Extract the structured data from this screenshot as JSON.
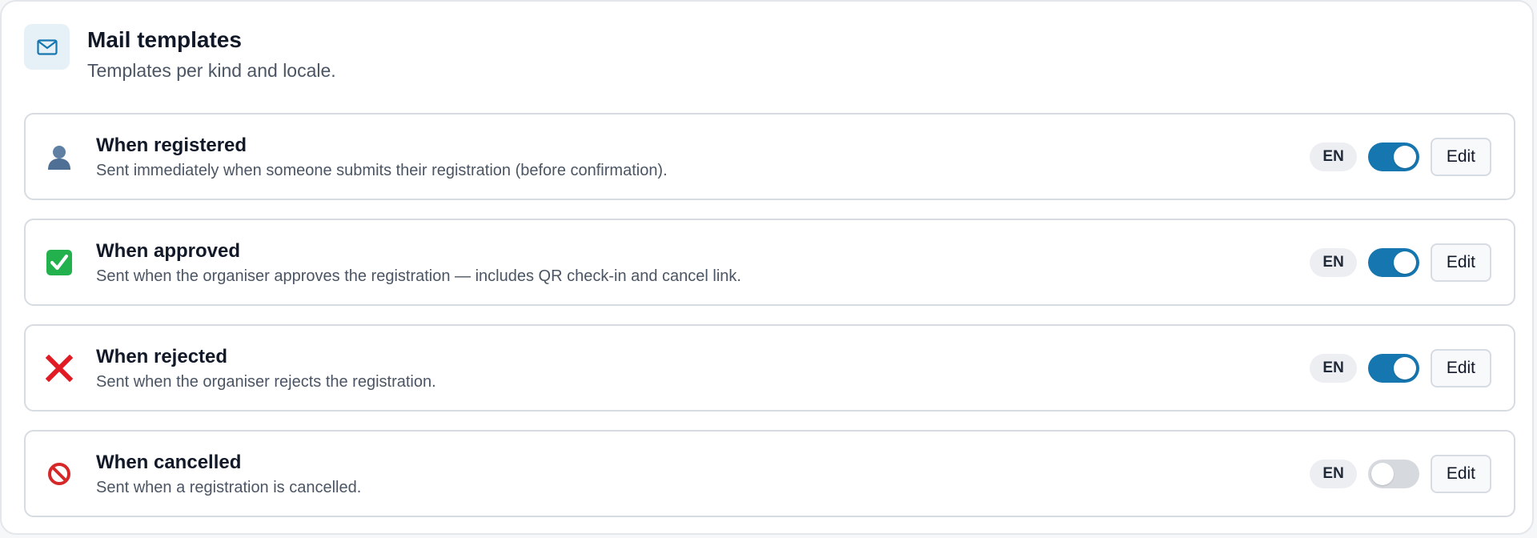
{
  "header": {
    "title": "Mail templates",
    "subtitle": "Templates per kind and locale.",
    "icon": "mail-icon",
    "accent": "#1677b0"
  },
  "templates": [
    {
      "title": "When registered",
      "description": "Sent immediately when someone submits their registration (before confirmation).",
      "icon": "person-icon",
      "locale": "EN",
      "enabled": true,
      "edit_label": "Edit"
    },
    {
      "title": "When approved",
      "description": "Sent when the organiser approves the registration — includes QR check-in and cancel link.",
      "icon": "check-mark-icon",
      "locale": "EN",
      "enabled": true,
      "edit_label": "Edit"
    },
    {
      "title": "When rejected",
      "description": "Sent when the organiser rejects the registration.",
      "icon": "cross-mark-icon",
      "locale": "EN",
      "enabled": true,
      "edit_label": "Edit"
    },
    {
      "title": "When cancelled",
      "description": "Sent when a registration is cancelled.",
      "icon": "prohibited-icon",
      "locale": "EN",
      "enabled": false,
      "edit_label": "Edit"
    }
  ]
}
